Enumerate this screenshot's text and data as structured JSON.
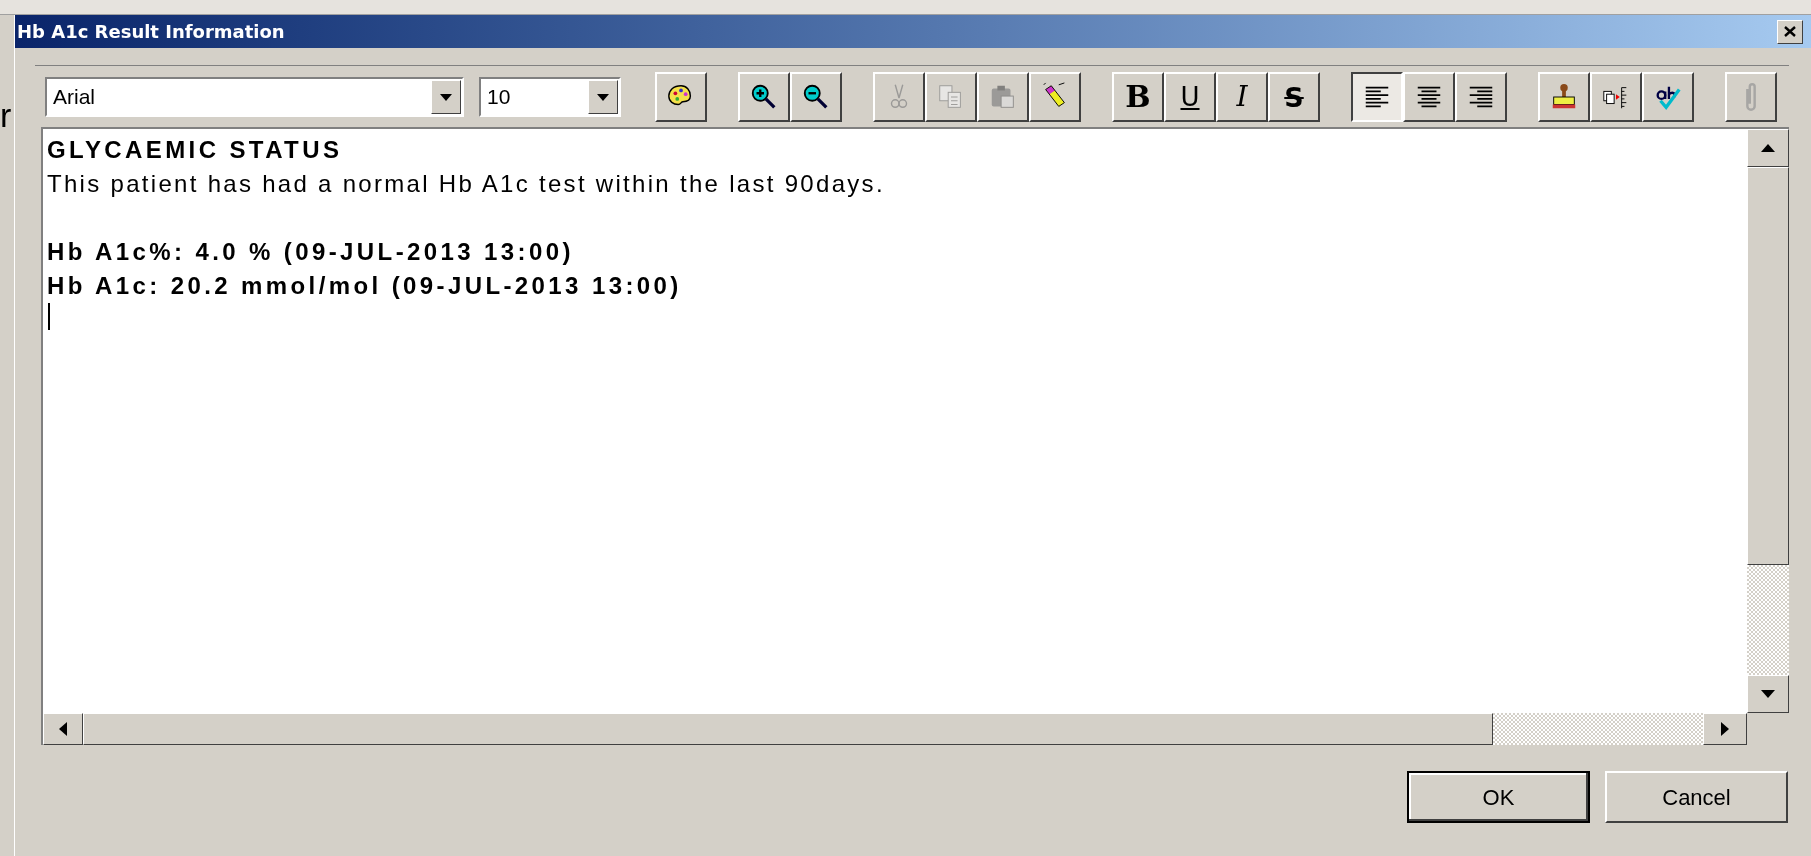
{
  "background_text": "r",
  "window": {
    "title": "Hb A1c Result Information"
  },
  "toolbar": {
    "font": "Arial",
    "size": "10",
    "groups": [
      [
        {
          "kind": "palette",
          "disabled": false
        }
      ],
      [
        {
          "kind": "zoom-in",
          "disabled": false
        },
        {
          "kind": "zoom-out",
          "disabled": false
        }
      ],
      [
        {
          "kind": "cut",
          "disabled": true
        },
        {
          "kind": "copy",
          "disabled": true
        },
        {
          "kind": "paste",
          "disabled": true
        },
        {
          "kind": "highlighter",
          "disabled": false
        }
      ],
      [
        {
          "kind": "bold",
          "label": "B",
          "disabled": false
        },
        {
          "kind": "underline",
          "label": "U",
          "disabled": false
        },
        {
          "kind": "italic",
          "label": "I",
          "disabled": false
        },
        {
          "kind": "strike",
          "label": "S",
          "disabled": false
        }
      ],
      [
        {
          "kind": "align-left",
          "selected": true
        },
        {
          "kind": "align-center",
          "selected": false
        },
        {
          "kind": "align-right",
          "selected": false
        }
      ],
      [
        {
          "kind": "stamp",
          "disabled": false
        },
        {
          "kind": "insert",
          "disabled": false
        },
        {
          "kind": "spell",
          "disabled": false
        }
      ],
      [
        {
          "kind": "attach",
          "disabled": true
        }
      ]
    ]
  },
  "editor": {
    "paragraphs": [
      [
        {
          "text": "GLYCAEMIC STATUS",
          "bold": true
        },
        {
          "text": "This patient has had a normal Hb A1c test within the last 90days.",
          "bold": false
        }
      ],
      [
        {
          "text": "Hb A1c%: 4.0 % (09-JUL-2013 13:00)",
          "bold": true
        },
        {
          "text": "Hb A1c: 20.2 mmol/mol (09-JUL-2013 13:00)",
          "bold": true
        }
      ]
    ]
  },
  "buttons": [
    {
      "label": "OK",
      "default": true
    },
    {
      "label": "Cancel",
      "default": false
    }
  ]
}
